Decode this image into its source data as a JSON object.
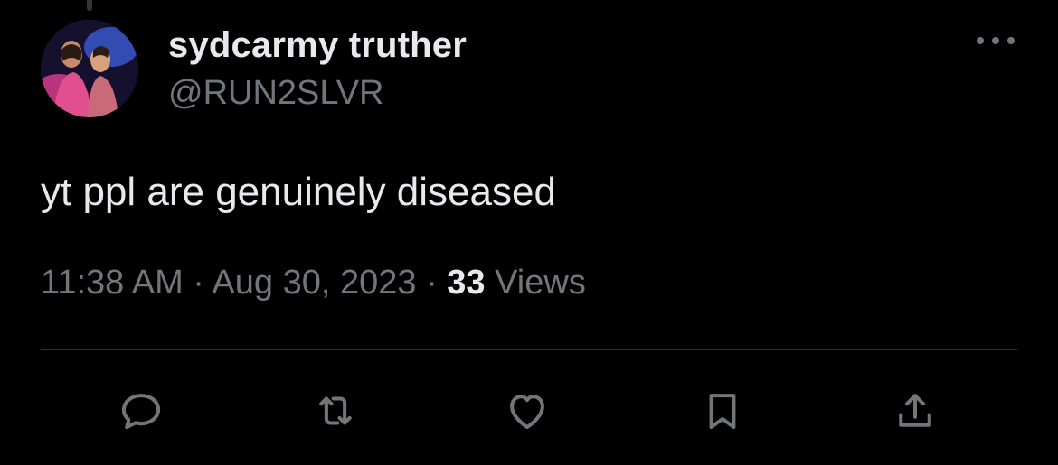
{
  "tweet": {
    "author": {
      "display_name": "sydcarmy truther",
      "handle": "@RUN2SLVR",
      "avatar": "profile-photo"
    },
    "text": "yt ppl are genuinely diseased",
    "time": "11:38 AM",
    "separator": "·",
    "date": "Aug 30, 2023",
    "views_count": "33",
    "views_label": "Views"
  },
  "actions": [
    {
      "name": "reply",
      "icon": "comment-bubble-icon"
    },
    {
      "name": "retweet",
      "icon": "retweet-icon"
    },
    {
      "name": "like",
      "icon": "heart-icon"
    },
    {
      "name": "bookmark",
      "icon": "bookmark-icon"
    },
    {
      "name": "share",
      "icon": "share-icon"
    }
  ],
  "colors": {
    "background": "#000000",
    "primary_text": "#e7e9ea",
    "secondary_text": "#71767b",
    "divider": "#2f3336"
  }
}
